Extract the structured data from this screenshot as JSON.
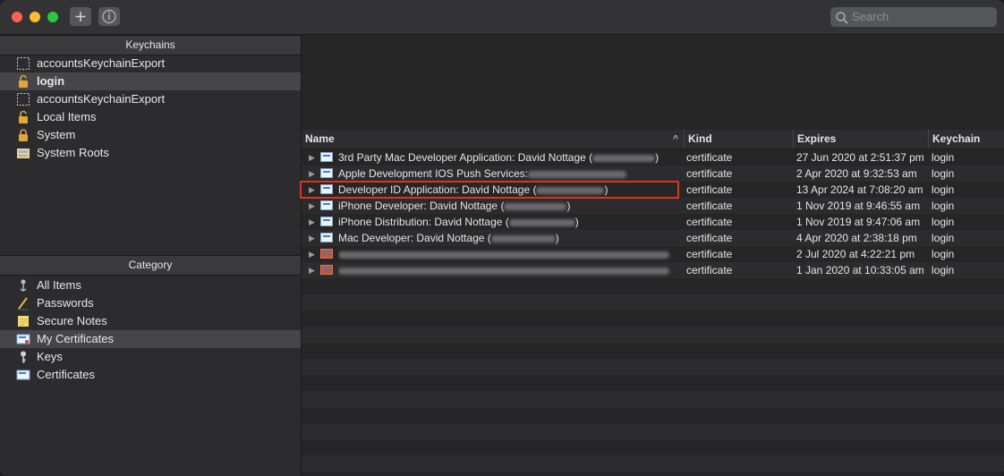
{
  "search": {
    "placeholder": "Search"
  },
  "sidebar": {
    "keychains_header": "Keychains",
    "keychains": [
      {
        "label": "accountsKeychainExport",
        "icon": "empty-keychain-icon",
        "selected": false,
        "bold": false
      },
      {
        "label": "login",
        "icon": "unlocked-padlock-icon",
        "selected": true,
        "bold": true
      },
      {
        "label": "accountsKeychainExport",
        "icon": "empty-keychain-icon",
        "selected": false,
        "bold": false
      },
      {
        "label": "Local Items",
        "icon": "unlocked-padlock-icon",
        "selected": false,
        "bold": false
      },
      {
        "label": "System",
        "icon": "locked-padlock-icon",
        "selected": false,
        "bold": false
      },
      {
        "label": "System Roots",
        "icon": "cabinet-icon",
        "selected": false,
        "bold": false
      }
    ],
    "category_header": "Category",
    "categories": [
      {
        "label": "All Items",
        "icon": "all-items-icon",
        "selected": false
      },
      {
        "label": "Passwords",
        "icon": "pen-icon",
        "selected": false
      },
      {
        "label": "Secure Notes",
        "icon": "note-icon",
        "selected": false
      },
      {
        "label": "My Certificates",
        "icon": "my-certificates-icon",
        "selected": true
      },
      {
        "label": "Keys",
        "icon": "key-icon",
        "selected": false
      },
      {
        "label": "Certificates",
        "icon": "certificate-icon",
        "selected": false
      }
    ]
  },
  "table": {
    "columns": [
      "Name",
      "Kind",
      "Expires",
      "Keychain"
    ],
    "rows": [
      {
        "name": "3rd Party Mac Developer Application: David Nottage (",
        "name_suffix": ")",
        "blur_w": 70,
        "kind": "certificate",
        "expires": "27 Jun 2020 at 2:51:37 pm",
        "keychain": "login",
        "icon": "certificate-icon"
      },
      {
        "name": "Apple Development IOS Push Services:",
        "name_suffix": "",
        "blur_w": 110,
        "kind": "certificate",
        "expires": "2 Apr 2020 at 9:32:53 am",
        "keychain": "login",
        "icon": "certificate-icon"
      },
      {
        "name": "Developer ID Application: David Nottage (",
        "name_suffix": ")",
        "blur_w": 76,
        "kind": "certificate",
        "expires": "13 Apr 2024 at 7:08:20 am",
        "keychain": "login",
        "icon": "certificate-icon"
      },
      {
        "name": "iPhone Developer: David Nottage (",
        "name_suffix": ")",
        "blur_w": 70,
        "kind": "certificate",
        "expires": "1 Nov 2019 at 9:46:55 am",
        "keychain": "login",
        "icon": "certificate-icon"
      },
      {
        "name": "iPhone Distribution: David Nottage (",
        "name_suffix": ")",
        "blur_w": 74,
        "kind": "certificate",
        "expires": "1 Nov 2019 at 9:47:06 am",
        "keychain": "login",
        "icon": "certificate-icon"
      },
      {
        "name": "Mac Developer: David Nottage (",
        "name_suffix": ")",
        "blur_w": 72,
        "kind": "certificate",
        "expires": "4 Apr 2020 at 2:38:18 pm",
        "keychain": "login",
        "icon": "certificate-icon"
      },
      {
        "name": "",
        "name_suffix": "",
        "blur_w": 370,
        "kind": "certificate",
        "expires": "2 Jul 2020 at 4:22:21 pm",
        "keychain": "login",
        "icon": "member-certificate-icon"
      },
      {
        "name": "",
        "name_suffix": "",
        "blur_w": 370,
        "kind": "certificate",
        "expires": "1 Jan 2020 at 10:33:05 am",
        "keychain": "login",
        "icon": "member-certificate-icon"
      }
    ]
  },
  "colors": {
    "highlight": "#e0321e",
    "selection": "#464649"
  }
}
